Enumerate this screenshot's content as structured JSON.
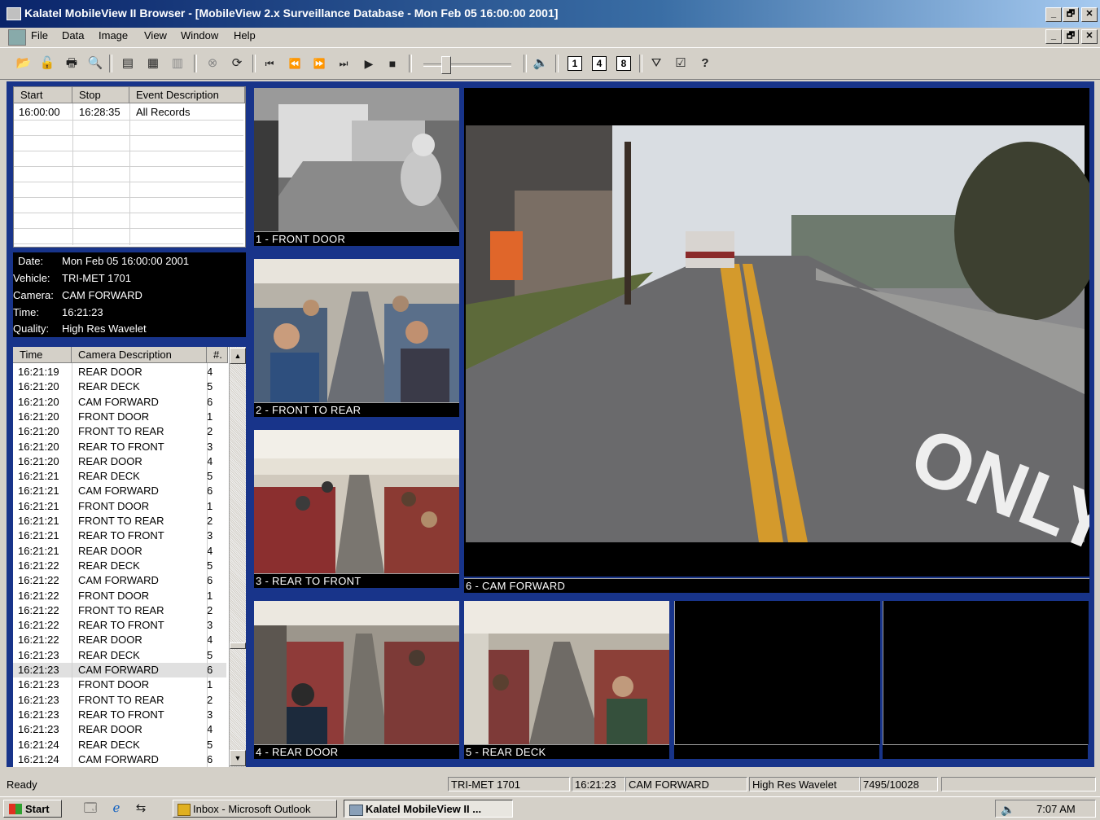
{
  "window": {
    "title": "Kalatel MobileView II Browser - [MobileView 2.x Surveillance Database - Mon Feb 05 16:00:00 2001]",
    "controls": [
      "_",
      "🗗",
      "✕"
    ]
  },
  "menu": [
    "File",
    "Data",
    "Image",
    "View",
    "Window",
    "Help"
  ],
  "toolbar": {
    "icons": [
      "open-icon",
      "lock-icon",
      "print-icon",
      "print-preview-icon",
      "export-icon",
      "copy-icon",
      "paste-icon",
      "stop-icon",
      "refresh-icon",
      "first-icon",
      "rewind-icon",
      "forward-icon",
      "last-icon",
      "play-icon",
      "stop-square-icon",
      "speaker-icon",
      "filter-icon",
      "properties-icon",
      "help-icon"
    ],
    "layout_buttons": [
      "1",
      "4",
      "8"
    ]
  },
  "events": {
    "headers": [
      "Start",
      "Stop",
      "Event Description"
    ],
    "rows": [
      {
        "start": "16:00:00",
        "stop": "16:28:35",
        "desc": "All Records"
      }
    ]
  },
  "info": {
    "date_label": "Date:",
    "date": "Mon Feb 05 16:00:00 2001",
    "vehicle_label": "Vehicle:",
    "vehicle": "TRI-MET 1701",
    "camera_label": "Camera:",
    "camera": "CAM FORWARD",
    "time_label": "Time:",
    "time": "16:21:23",
    "quality_label": "Quality:",
    "quality": "High Res Wavelet"
  },
  "camera_log": {
    "headers": [
      "Time",
      "Camera Description",
      "#."
    ],
    "selected_index": 20,
    "rows": [
      {
        "time": "16:21:19",
        "desc": "REAR DOOR",
        "num": "4"
      },
      {
        "time": "16:21:20",
        "desc": "REAR DECK",
        "num": "5"
      },
      {
        "time": "16:21:20",
        "desc": "CAM FORWARD",
        "num": "6"
      },
      {
        "time": "16:21:20",
        "desc": "FRONT DOOR",
        "num": "1"
      },
      {
        "time": "16:21:20",
        "desc": "FRONT TO REAR",
        "num": "2"
      },
      {
        "time": "16:21:20",
        "desc": "REAR TO FRONT",
        "num": "3"
      },
      {
        "time": "16:21:20",
        "desc": "REAR DOOR",
        "num": "4"
      },
      {
        "time": "16:21:21",
        "desc": "REAR DECK",
        "num": "5"
      },
      {
        "time": "16:21:21",
        "desc": "CAM FORWARD",
        "num": "6"
      },
      {
        "time": "16:21:21",
        "desc": "FRONT DOOR",
        "num": "1"
      },
      {
        "time": "16:21:21",
        "desc": "FRONT TO REAR",
        "num": "2"
      },
      {
        "time": "16:21:21",
        "desc": "REAR TO FRONT",
        "num": "3"
      },
      {
        "time": "16:21:21",
        "desc": "REAR DOOR",
        "num": "4"
      },
      {
        "time": "16:21:22",
        "desc": "REAR DECK",
        "num": "5"
      },
      {
        "time": "16:21:22",
        "desc": "CAM FORWARD",
        "num": "6"
      },
      {
        "time": "16:21:22",
        "desc": "FRONT DOOR",
        "num": "1"
      },
      {
        "time": "16:21:22",
        "desc": "FRONT TO REAR",
        "num": "2"
      },
      {
        "time": "16:21:22",
        "desc": "REAR TO FRONT",
        "num": "3"
      },
      {
        "time": "16:21:22",
        "desc": "REAR DOOR",
        "num": "4"
      },
      {
        "time": "16:21:23",
        "desc": "REAR DECK",
        "num": "5"
      },
      {
        "time": "16:21:23",
        "desc": "CAM FORWARD",
        "num": "6"
      },
      {
        "time": "16:21:23",
        "desc": "FRONT DOOR",
        "num": "1"
      },
      {
        "time": "16:21:23",
        "desc": "FRONT TO REAR",
        "num": "2"
      },
      {
        "time": "16:21:23",
        "desc": "REAR TO FRONT",
        "num": "3"
      },
      {
        "time": "16:21:23",
        "desc": "REAR DOOR",
        "num": "4"
      },
      {
        "time": "16:21:24",
        "desc": "REAR DECK",
        "num": "5"
      },
      {
        "time": "16:21:24",
        "desc": "CAM FORWARD",
        "num": "6"
      }
    ]
  },
  "cameras": {
    "cam1": "1 - FRONT DOOR",
    "cam2": "2 - FRONT TO REAR",
    "cam3": "3 - REAR TO FRONT",
    "cam4": "4 - REAR DOOR",
    "cam5": "5 - REAR DECK",
    "cam6": "6 - CAM FORWARD",
    "road_text": "ONLY"
  },
  "status": {
    "ready": "Ready",
    "vehicle": "TRI-MET 1701",
    "time": "16:21:23",
    "camera": "CAM FORWARD",
    "quality": "High Res Wavelet",
    "record": "7495/10028"
  },
  "taskbar": {
    "start": "Start",
    "task1": "Inbox - Microsoft Outlook",
    "task2": "Kalatel MobileView II ...",
    "clock": "7:07 AM"
  }
}
